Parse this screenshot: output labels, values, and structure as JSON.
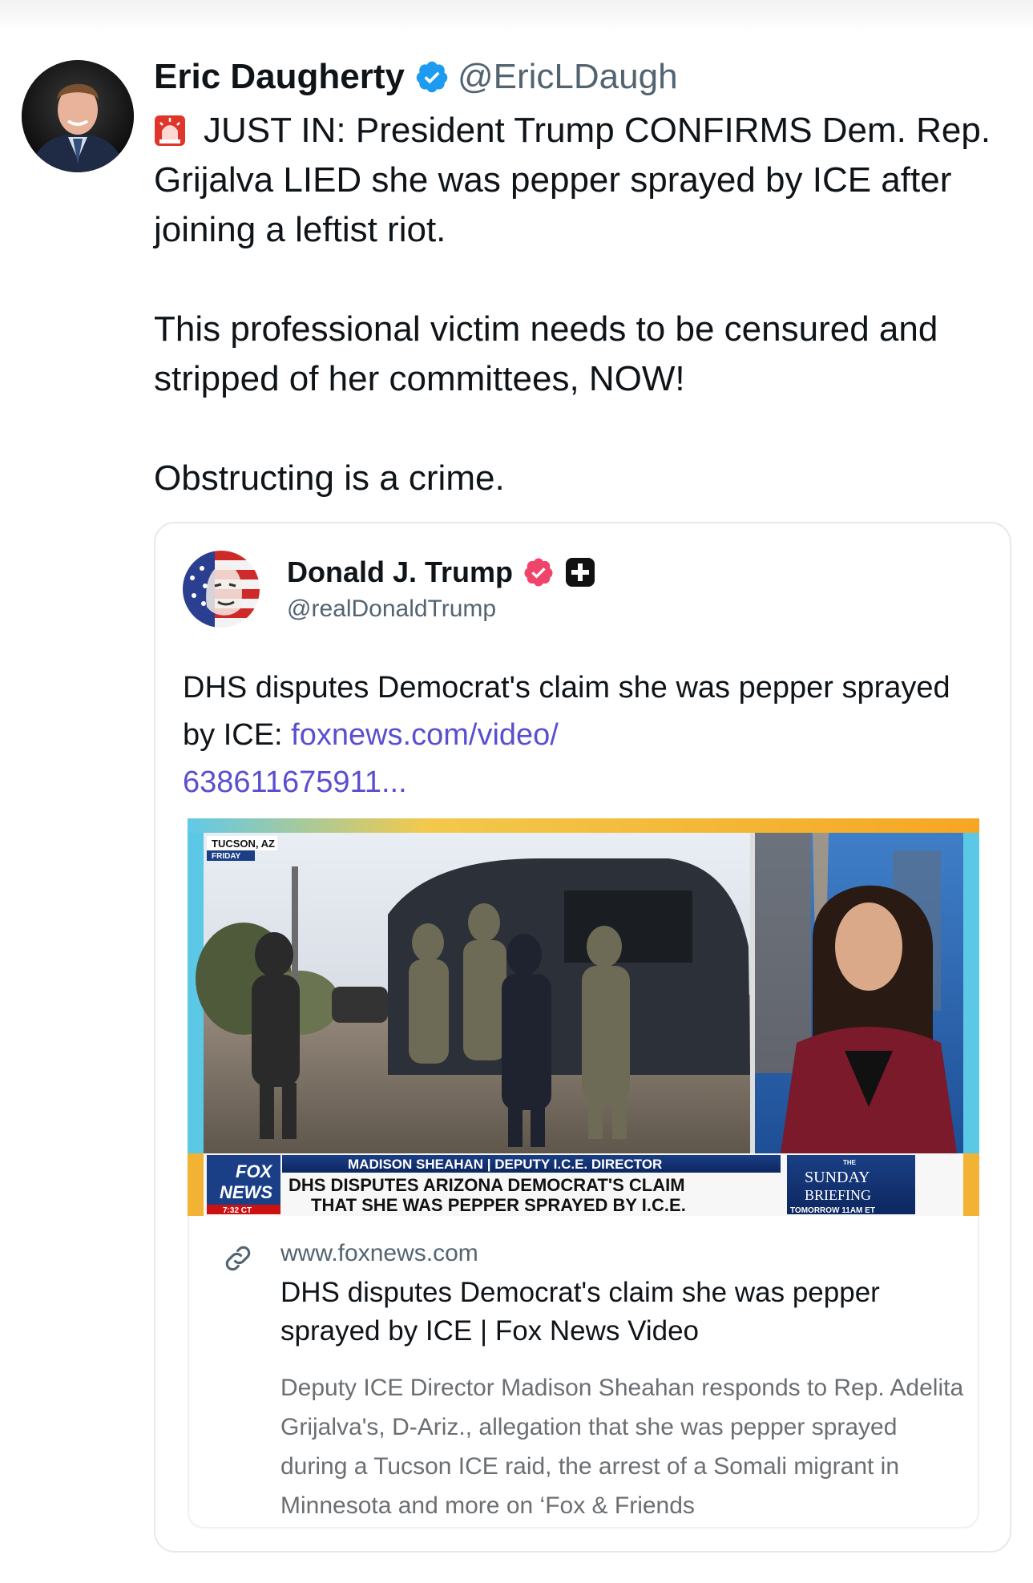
{
  "tweet": {
    "author": {
      "name": "Eric Daugherty",
      "handle": "@EricLDaugh"
    },
    "lines": [
      "JUST IN: President Trump CONFIRMS Dem. Rep. Grijalva LIED she was pepper sprayed by ICE after joining a leftist riot.",
      "This professional victim needs to be censured and stripped of her committees, NOW!",
      "Obstructing is a crime."
    ]
  },
  "quote": {
    "author": {
      "name": "Donald J. Trump",
      "handle": "@realDonaldTrump"
    },
    "text_prefix": "DHS disputes Democrat's claim she was pepper sprayed by ICE: ",
    "link_text": "foxnews.com/video/\n638611675911...",
    "media": {
      "location": "TUCSON, AZ",
      "day": "FRIDAY",
      "network_top": "FOX",
      "network_bottom": "NEWS",
      "time": "7:32 CT",
      "chyron_name": "MADISON SHEAHAN | DEPUTY I.C.E. DIRECTOR",
      "chyron_line1": "DHS DISPUTES ARIZONA DEMOCRAT'S CLAIM",
      "chyron_line2": "THAT SHE WAS PEPPER SPRAYED BY I.C.E.",
      "promo_small": "THE",
      "promo_line1": "SUNDAY",
      "promo_line2": "BRIEFING",
      "promo_time": "TOMORROW 11AM ET"
    },
    "link_card": {
      "domain": "www.foxnews.com",
      "title": "DHS disputes Democrat's claim she was pepper sprayed by ICE | Fox News Video",
      "description": "Deputy ICE Director Madison Sheahan responds to Rep. Adelita Grijalva's, D-Ariz., allegation that she was pepper sprayed during a Tucson ICE raid, the arrest of a Somali migrant in Minnesota and more on ‘Fox & Friends"
    }
  },
  "colors": {
    "verified_blue": "#1d9bf0",
    "verified_pink": "#f0446b",
    "link": "#5a4fcf",
    "secondary_text": "#536471"
  }
}
